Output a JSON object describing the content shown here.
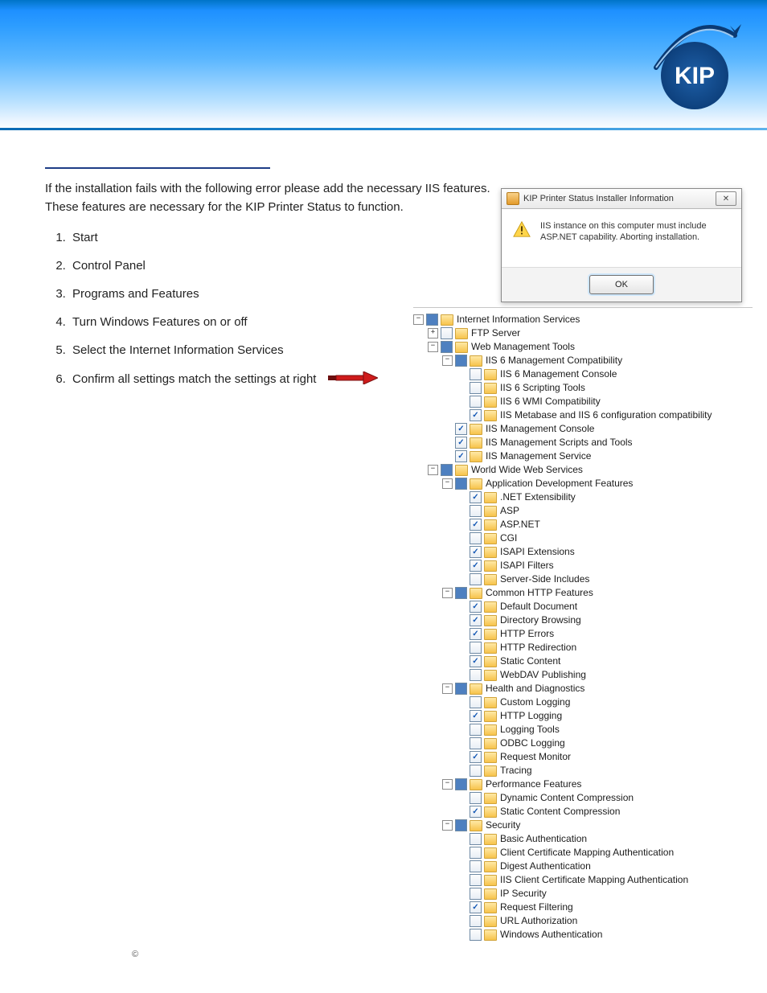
{
  "logo_text": "KIP",
  "intro": "If the installation fails with the following error please add the necessary IIS features. These features are necessary for the KIP Printer Status to function.",
  "steps": [
    "Start",
    "Control Panel",
    "Programs and Features",
    "Turn Windows Features on or off",
    "Select the Internet Information Services",
    "Confirm all settings match the settings at right"
  ],
  "dialog": {
    "title": "KIP Printer Status Installer Information",
    "message": "IIS instance on this computer must include ASP.NET capability. Aborting installation.",
    "ok": "OK",
    "close": "✕"
  },
  "tree": [
    {
      "exp": "-",
      "chk": "filled",
      "label": "Internet Information Services",
      "children": [
        {
          "exp": "+",
          "chk": "empty",
          "label": "FTP Server"
        },
        {
          "exp": "-",
          "chk": "filled",
          "label": "Web Management Tools",
          "children": [
            {
              "exp": "-",
              "chk": "filled",
              "label": "IIS 6 Management Compatibility",
              "children": [
                {
                  "exp": "",
                  "chk": "empty",
                  "label": "IIS 6 Management Console"
                },
                {
                  "exp": "",
                  "chk": "empty",
                  "label": "IIS 6 Scripting Tools"
                },
                {
                  "exp": "",
                  "chk": "empty",
                  "label": "IIS 6 WMI Compatibility"
                },
                {
                  "exp": "",
                  "chk": "checked",
                  "label": "IIS Metabase and IIS 6 configuration compatibility"
                }
              ]
            },
            {
              "exp": "",
              "chk": "checked",
              "label": "IIS Management Console"
            },
            {
              "exp": "",
              "chk": "checked",
              "label": "IIS Management Scripts and Tools"
            },
            {
              "exp": "",
              "chk": "checked",
              "label": "IIS Management Service"
            }
          ]
        },
        {
          "exp": "-",
          "chk": "filled",
          "label": "World Wide Web Services",
          "children": [
            {
              "exp": "-",
              "chk": "filled",
              "label": "Application Development Features",
              "children": [
                {
                  "exp": "",
                  "chk": "checked",
                  "label": ".NET Extensibility"
                },
                {
                  "exp": "",
                  "chk": "empty",
                  "label": "ASP"
                },
                {
                  "exp": "",
                  "chk": "checked",
                  "label": "ASP.NET"
                },
                {
                  "exp": "",
                  "chk": "empty",
                  "label": "CGI"
                },
                {
                  "exp": "",
                  "chk": "checked",
                  "label": "ISAPI Extensions"
                },
                {
                  "exp": "",
                  "chk": "checked",
                  "label": "ISAPI Filters"
                },
                {
                  "exp": "",
                  "chk": "empty",
                  "label": "Server-Side Includes"
                }
              ]
            },
            {
              "exp": "-",
              "chk": "filled",
              "label": "Common HTTP Features",
              "children": [
                {
                  "exp": "",
                  "chk": "checked",
                  "label": "Default Document"
                },
                {
                  "exp": "",
                  "chk": "checked",
                  "label": "Directory Browsing"
                },
                {
                  "exp": "",
                  "chk": "checked",
                  "label": "HTTP Errors"
                },
                {
                  "exp": "",
                  "chk": "empty",
                  "label": "HTTP Redirection"
                },
                {
                  "exp": "",
                  "chk": "checked",
                  "label": "Static Content"
                },
                {
                  "exp": "",
                  "chk": "empty",
                  "label": "WebDAV Publishing"
                }
              ]
            },
            {
              "exp": "-",
              "chk": "filled",
              "label": "Health and Diagnostics",
              "children": [
                {
                  "exp": "",
                  "chk": "empty",
                  "label": "Custom Logging"
                },
                {
                  "exp": "",
                  "chk": "checked",
                  "label": "HTTP Logging"
                },
                {
                  "exp": "",
                  "chk": "empty",
                  "label": "Logging Tools"
                },
                {
                  "exp": "",
                  "chk": "empty",
                  "label": "ODBC Logging"
                },
                {
                  "exp": "",
                  "chk": "checked",
                  "label": "Request Monitor"
                },
                {
                  "exp": "",
                  "chk": "empty",
                  "label": "Tracing"
                }
              ]
            },
            {
              "exp": "-",
              "chk": "filled",
              "label": "Performance Features",
              "children": [
                {
                  "exp": "",
                  "chk": "empty",
                  "label": "Dynamic Content Compression"
                },
                {
                  "exp": "",
                  "chk": "checked",
                  "label": "Static Content Compression"
                }
              ]
            },
            {
              "exp": "-",
              "chk": "filled",
              "label": "Security",
              "children": [
                {
                  "exp": "",
                  "chk": "empty",
                  "label": "Basic Authentication"
                },
                {
                  "exp": "",
                  "chk": "empty",
                  "label": "Client Certificate Mapping Authentication"
                },
                {
                  "exp": "",
                  "chk": "empty",
                  "label": "Digest Authentication"
                },
                {
                  "exp": "",
                  "chk": "empty",
                  "label": "IIS Client Certificate Mapping Authentication"
                },
                {
                  "exp": "",
                  "chk": "empty",
                  "label": "IP Security"
                },
                {
                  "exp": "",
                  "chk": "checked",
                  "label": "Request Filtering"
                },
                {
                  "exp": "",
                  "chk": "empty",
                  "label": "URL Authorization"
                },
                {
                  "exp": "",
                  "chk": "empty",
                  "label": "Windows Authentication"
                }
              ]
            }
          ]
        }
      ]
    }
  ],
  "copyright": "©"
}
